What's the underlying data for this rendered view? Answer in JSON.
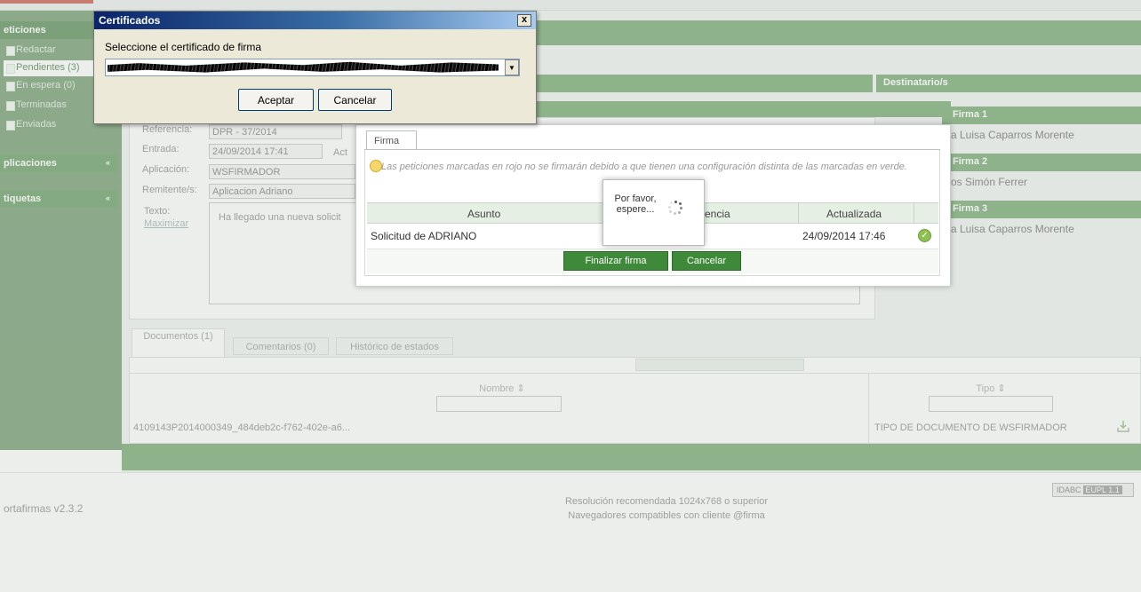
{
  "sidebar": {
    "section_title": "eticiones",
    "items": [
      {
        "label": "Redactar"
      },
      {
        "label": "Pendientes (3)"
      },
      {
        "label": "En espera (0)"
      },
      {
        "label": "Terminadas"
      },
      {
        "label": "Enviadas"
      }
    ],
    "apps_label": "plicaciones",
    "tags_label": "tiquetas"
  },
  "detail": {
    "referencia_label": "Referencia:",
    "referencia_value": "DPR - 37/2014",
    "entrada_label": "Entrada:",
    "entrada_value": "24/09/2014 17:41",
    "actualizada_label": "Act",
    "aplicacion_label": "Aplicación:",
    "aplicacion_value": "WSFIRMADOR",
    "remitente_label": "Remitente/s:",
    "remitente_value": "Aplicacion Adriano",
    "texto_label": "Texto:",
    "maximizar_label": "Maximizar",
    "texto_value": "Ha llegado una nueva solicit"
  },
  "destinatarios": {
    "header": "Destinatario/s",
    "signers": [
      {
        "head": "Firma 1",
        "name": "a Luisa Caparros Morente"
      },
      {
        "head": "Firma 2",
        "name": "os Simón Ferrer"
      },
      {
        "head": "Firma 3",
        "name": "a Luisa Caparros Morente"
      }
    ]
  },
  "documents": {
    "tabs": [
      {
        "label": "Documentos (1)"
      },
      {
        "label": "Comentarios (0)"
      },
      {
        "label": "Histórico de estados"
      }
    ],
    "col_nombre": "Nombre ⇕",
    "col_tipo": "Tipo ⇕",
    "row": {
      "nombre": "4109143P2014000349_484deb2c-f762-402e-a6...",
      "tipo": "TIPO DE DOCUMENTO DE WSFIRMADOR"
    }
  },
  "footer": {
    "version": "ortafirmas v2.3.2",
    "line1": "Resolución recomendada 1024x768 o superior",
    "line2": "Navegadores compatibles con cliente @firma",
    "badge_a": "IDABC",
    "badge_b": "EUPL 1.1"
  },
  "firma_modal": {
    "tab_label": "Firma",
    "warning": "Las peticiones marcadas en rojo no se firmarán debido a que tienen una configuración distinta de las marcadas en verde.",
    "col_asunto": "Asunto",
    "col_ref": "encia",
    "col_actualizada": "Actualizada",
    "row": {
      "asunto": "Solicitud de ADRIANO",
      "actualizada": "24/09/2014 17:46"
    },
    "finalizar_label": "Finalizar firma",
    "cancelar_label": "Cancelar",
    "wait_text": "Por favor, espere..."
  },
  "cert_dialog": {
    "title": "Certificados",
    "close_label": "x",
    "prompt": "Seleccione el certificado de firma",
    "aceptar_label": "Aceptar",
    "cancelar_label": "Cancelar"
  },
  "colors": {
    "brand_green": "#5d9a58",
    "dark_green": "#3f7a3b",
    "title_blue": "#0a246a"
  }
}
